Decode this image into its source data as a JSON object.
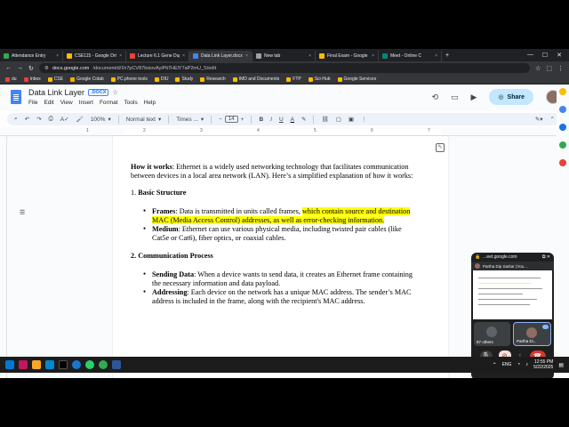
{
  "tabs": [
    {
      "title": "Attendance Entry",
      "color": "#34a853"
    },
    {
      "title": "CSE115 - Google Driv",
      "color": "#fbbc04"
    },
    {
      "title": "Lecture 6.1 Gene Dup",
      "color": "#ea4335"
    },
    {
      "title": "Data Link Layer.docx",
      "color": "#4285f4",
      "active": true
    },
    {
      "title": "New tab",
      "color": "#9aa0a6"
    },
    {
      "title": "Final Exam - Google",
      "color": "#fbbc04"
    },
    {
      "title": "Meet - Online C",
      "color": "#00897b"
    }
  ],
  "tab_close": "×",
  "new_tab": "+",
  "window_controls": {
    "minimize": "—",
    "maximize": "☐",
    "close": "✕"
  },
  "address": {
    "host": "docs.google.com",
    "path": "/document/d/1h7pCV87bsiovAyiPti7HElY7aP2mU_S/edit"
  },
  "bookmarks": [
    "du",
    "Inbox",
    "CSE",
    "Google Colab",
    "PC.phone tools",
    "DIU",
    "Study",
    "Research",
    "IMD and Documents",
    "FTP",
    "Sci-Hub",
    "Google Services"
  ],
  "doc": {
    "title": "Data Link Layer",
    "badge": ".DOCX",
    "menus": [
      "File",
      "Edit",
      "View",
      "Insert",
      "Format",
      "Tools",
      "Help"
    ],
    "share_label": "Share"
  },
  "toolbar": {
    "zoom": "100%",
    "style": "Normal text",
    "font": "Times ...",
    "font_size": "14",
    "minus": "−",
    "plus": "+"
  },
  "ruler": [
    "1",
    "2",
    "3",
    "4",
    "5",
    "6",
    "7"
  ],
  "content": {
    "intro_label": "How it works",
    "intro_text": ": Ethernet is a widely used networking technology that facilitates communication between devices in a local area network (LAN). Here’s a simplified explanation of how it works:",
    "sec1_num": "1.",
    "sec1_title": "Basic Structure",
    "frames_label": "Frames",
    "frames_plain": ": Data is transmitted in units called frames, ",
    "frames_hl": "which contain source and destination MAC (Media Access Control) addresses, as well as error-checking information.",
    "medium_label": "Medium",
    "medium_text": ": Ethernet can use various physical media, including twisted pair cables (like Cat5e or Cat6), fiber optics, or coaxial cables.",
    "sec2_num": "2.",
    "sec2_title": "Communication Process",
    "sending_label": "Sending Data",
    "sending_text": ": When a device wants to send data, it creates an Ethernet frame containing the necessary information and data payload.",
    "addressing_label": "Addressing",
    "addressing_text": ": Each device on the network has a unique MAC address. The sender’s MAC address is included in the frame, along with the recipient's MAC address."
  },
  "meet": {
    "url": "...eet.google.com",
    "presenter": "Partha Dip Sarkar (You...",
    "others_label": "97 others",
    "self_label": "Partha Di...",
    "badge": "1"
  },
  "clock": {
    "time": "12:55 PM",
    "date": "5/22/2025"
  },
  "lang": "ENG"
}
